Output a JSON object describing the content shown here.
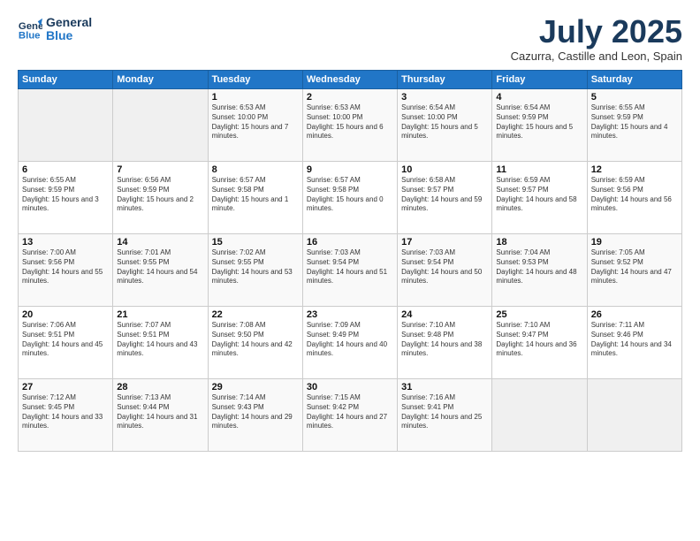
{
  "header": {
    "logo_line1": "General",
    "logo_line2": "Blue",
    "month_title": "July 2025",
    "subtitle": "Cazurra, Castille and Leon, Spain"
  },
  "days_of_week": [
    "Sunday",
    "Monday",
    "Tuesday",
    "Wednesday",
    "Thursday",
    "Friday",
    "Saturday"
  ],
  "weeks": [
    [
      {
        "day": "",
        "info": ""
      },
      {
        "day": "",
        "info": ""
      },
      {
        "day": "1",
        "info": "Sunrise: 6:53 AM\nSunset: 10:00 PM\nDaylight: 15 hours and 7 minutes."
      },
      {
        "day": "2",
        "info": "Sunrise: 6:53 AM\nSunset: 10:00 PM\nDaylight: 15 hours and 6 minutes."
      },
      {
        "day": "3",
        "info": "Sunrise: 6:54 AM\nSunset: 10:00 PM\nDaylight: 15 hours and 5 minutes."
      },
      {
        "day": "4",
        "info": "Sunrise: 6:54 AM\nSunset: 9:59 PM\nDaylight: 15 hours and 5 minutes."
      },
      {
        "day": "5",
        "info": "Sunrise: 6:55 AM\nSunset: 9:59 PM\nDaylight: 15 hours and 4 minutes."
      }
    ],
    [
      {
        "day": "6",
        "info": "Sunrise: 6:55 AM\nSunset: 9:59 PM\nDaylight: 15 hours and 3 minutes."
      },
      {
        "day": "7",
        "info": "Sunrise: 6:56 AM\nSunset: 9:59 PM\nDaylight: 15 hours and 2 minutes."
      },
      {
        "day": "8",
        "info": "Sunrise: 6:57 AM\nSunset: 9:58 PM\nDaylight: 15 hours and 1 minute."
      },
      {
        "day": "9",
        "info": "Sunrise: 6:57 AM\nSunset: 9:58 PM\nDaylight: 15 hours and 0 minutes."
      },
      {
        "day": "10",
        "info": "Sunrise: 6:58 AM\nSunset: 9:57 PM\nDaylight: 14 hours and 59 minutes."
      },
      {
        "day": "11",
        "info": "Sunrise: 6:59 AM\nSunset: 9:57 PM\nDaylight: 14 hours and 58 minutes."
      },
      {
        "day": "12",
        "info": "Sunrise: 6:59 AM\nSunset: 9:56 PM\nDaylight: 14 hours and 56 minutes."
      }
    ],
    [
      {
        "day": "13",
        "info": "Sunrise: 7:00 AM\nSunset: 9:56 PM\nDaylight: 14 hours and 55 minutes."
      },
      {
        "day": "14",
        "info": "Sunrise: 7:01 AM\nSunset: 9:55 PM\nDaylight: 14 hours and 54 minutes."
      },
      {
        "day": "15",
        "info": "Sunrise: 7:02 AM\nSunset: 9:55 PM\nDaylight: 14 hours and 53 minutes."
      },
      {
        "day": "16",
        "info": "Sunrise: 7:03 AM\nSunset: 9:54 PM\nDaylight: 14 hours and 51 minutes."
      },
      {
        "day": "17",
        "info": "Sunrise: 7:03 AM\nSunset: 9:54 PM\nDaylight: 14 hours and 50 minutes."
      },
      {
        "day": "18",
        "info": "Sunrise: 7:04 AM\nSunset: 9:53 PM\nDaylight: 14 hours and 48 minutes."
      },
      {
        "day": "19",
        "info": "Sunrise: 7:05 AM\nSunset: 9:52 PM\nDaylight: 14 hours and 47 minutes."
      }
    ],
    [
      {
        "day": "20",
        "info": "Sunrise: 7:06 AM\nSunset: 9:51 PM\nDaylight: 14 hours and 45 minutes."
      },
      {
        "day": "21",
        "info": "Sunrise: 7:07 AM\nSunset: 9:51 PM\nDaylight: 14 hours and 43 minutes."
      },
      {
        "day": "22",
        "info": "Sunrise: 7:08 AM\nSunset: 9:50 PM\nDaylight: 14 hours and 42 minutes."
      },
      {
        "day": "23",
        "info": "Sunrise: 7:09 AM\nSunset: 9:49 PM\nDaylight: 14 hours and 40 minutes."
      },
      {
        "day": "24",
        "info": "Sunrise: 7:10 AM\nSunset: 9:48 PM\nDaylight: 14 hours and 38 minutes."
      },
      {
        "day": "25",
        "info": "Sunrise: 7:10 AM\nSunset: 9:47 PM\nDaylight: 14 hours and 36 minutes."
      },
      {
        "day": "26",
        "info": "Sunrise: 7:11 AM\nSunset: 9:46 PM\nDaylight: 14 hours and 34 minutes."
      }
    ],
    [
      {
        "day": "27",
        "info": "Sunrise: 7:12 AM\nSunset: 9:45 PM\nDaylight: 14 hours and 33 minutes."
      },
      {
        "day": "28",
        "info": "Sunrise: 7:13 AM\nSunset: 9:44 PM\nDaylight: 14 hours and 31 minutes."
      },
      {
        "day": "29",
        "info": "Sunrise: 7:14 AM\nSunset: 9:43 PM\nDaylight: 14 hours and 29 minutes."
      },
      {
        "day": "30",
        "info": "Sunrise: 7:15 AM\nSunset: 9:42 PM\nDaylight: 14 hours and 27 minutes."
      },
      {
        "day": "31",
        "info": "Sunrise: 7:16 AM\nSunset: 9:41 PM\nDaylight: 14 hours and 25 minutes."
      },
      {
        "day": "",
        "info": ""
      },
      {
        "day": "",
        "info": ""
      }
    ]
  ]
}
